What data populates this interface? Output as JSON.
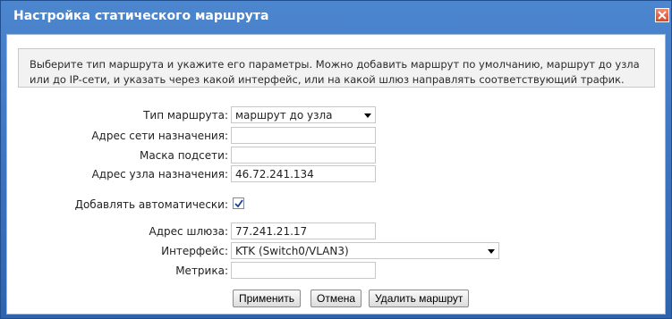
{
  "window": {
    "title": "Настройка статического маршрута",
    "close_icon": "close-icon"
  },
  "info": {
    "text": "Выберите тип маршрута и укажите его параметры. Можно добавить маршрут по умолчанию, маршрут до узла или до IP-сети, и указать через какой интерфейс, или на какой шлюз направлять соответствующий трафик."
  },
  "form": {
    "route_type": {
      "label": "Тип маршрута:",
      "value": "маршрут до узла"
    },
    "dest_network": {
      "label": "Адрес сети назначения:",
      "value": ""
    },
    "subnet_mask": {
      "label": "Маска подсети:",
      "value": ""
    },
    "dest_host": {
      "label": "Адрес узла назначения:",
      "value": "46.72.241.134"
    },
    "auto_add": {
      "label": "Добавлять автоматически:",
      "checked": true
    },
    "gateway": {
      "label": "Адрес шлюза:",
      "value": "77.241.21.17"
    },
    "interface": {
      "label": "Интерфейс:",
      "value": "KTK (Switch0/VLAN3)"
    },
    "metric": {
      "label": "Метрика:",
      "value": ""
    }
  },
  "buttons": {
    "apply": "Применить",
    "cancel": "Отмена",
    "delete": "Удалить маршрут"
  },
  "colors": {
    "titlebar": "#3f73b8",
    "close": "#d9472a",
    "info_bg": "#f2f2f2"
  }
}
